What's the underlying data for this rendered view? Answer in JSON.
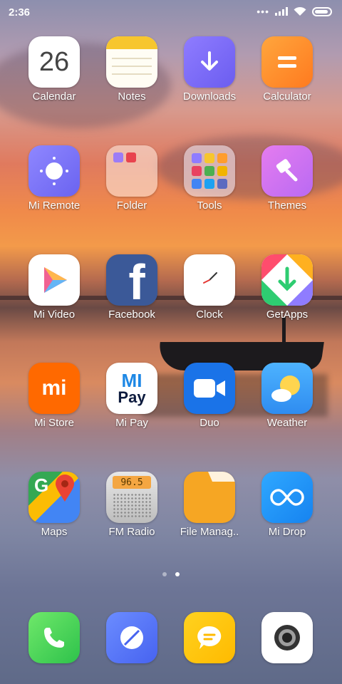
{
  "status": {
    "time": "2:36",
    "battery_level": 0.9
  },
  "apps": [
    {
      "id": "calendar",
      "label": "Calendar",
      "icon_text": "26"
    },
    {
      "id": "notes",
      "label": "Notes"
    },
    {
      "id": "downloads",
      "label": "Downloads"
    },
    {
      "id": "calculator",
      "label": "Calculator",
      "icon_text": "="
    },
    {
      "id": "mi-remote",
      "label": "Mi Remote"
    },
    {
      "id": "folder",
      "label": "Folder"
    },
    {
      "id": "tools",
      "label": "Tools"
    },
    {
      "id": "themes",
      "label": "Themes"
    },
    {
      "id": "mi-video",
      "label": "Mi Video"
    },
    {
      "id": "facebook",
      "label": "Facebook",
      "icon_text": "f"
    },
    {
      "id": "clock",
      "label": "Clock"
    },
    {
      "id": "getapps",
      "label": "GetApps"
    },
    {
      "id": "mi-store",
      "label": "Mi Store",
      "icon_text": "mi"
    },
    {
      "id": "mi-pay",
      "label": "Mi Pay",
      "icon_text_top": "MI",
      "icon_text_bottom": "Pay"
    },
    {
      "id": "duo",
      "label": "Duo"
    },
    {
      "id": "weather",
      "label": "Weather"
    },
    {
      "id": "maps",
      "label": "Maps",
      "icon_text": "G"
    },
    {
      "id": "fm-radio",
      "label": "FM Radio",
      "icon_text": "96.5"
    },
    {
      "id": "file-manager",
      "label": "File Manag.."
    },
    {
      "id": "mi-drop",
      "label": "Mi Drop"
    }
  ],
  "dock": [
    "phone",
    "browser",
    "messaging",
    "camera"
  ],
  "pager": {
    "pages": 2,
    "current": 2
  },
  "colors": {
    "label": "#ffffff"
  }
}
